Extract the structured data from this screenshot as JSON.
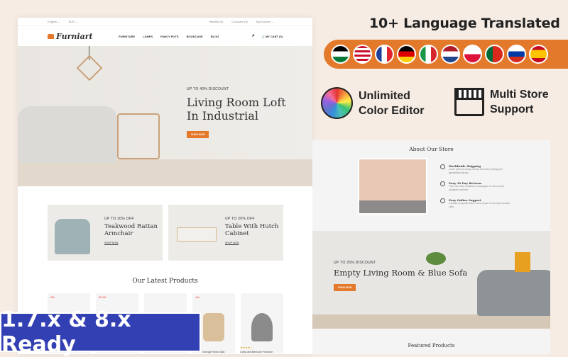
{
  "store": {
    "topbar": {
      "language": "English ⌄",
      "currency": "EUR ⌄",
      "wishlist": "Wishlist (0)",
      "compare": "Compare (0)",
      "account": "My Account ⌄"
    },
    "logo": "Furniart",
    "menu": [
      "FURNITURE",
      "LAMPS",
      "FANCY POTS",
      "BOOKCASE",
      "BLOG"
    ],
    "cart": "MY CART (0)",
    "hero": {
      "eyebrow": "UP TO 40% DISCOUNT",
      "title": "Living Room Loft In Industrial",
      "button": "SHOP NOW"
    },
    "banners": [
      {
        "eyebrow": "UP TO 30% OFF",
        "title": "Teakwood Rattan Armchair",
        "link": "SHOP NOW"
      },
      {
        "eyebrow": "UP TO 20% OFF",
        "title": "Table With Hutch Cabinet",
        "link": "SHOP NOW"
      }
    ],
    "latest_title": "Our Latest Products",
    "products": [
      {
        "badge": "-8%",
        "color": "#a94a46"
      },
      {
        "badge": "-€5.00",
        "color": "#e8a7a5"
      },
      {
        "badge": "",
        "color": "#a9c3cc"
      },
      {
        "badge": "-4%",
        "color": "#d9bf9a"
      },
      {
        "badge": "",
        "color": "#8b8b8b"
      }
    ],
    "product_names": [
      "Georgia Fabric Sofa",
      "Living and Bedroom Furniture"
    ],
    "rating": "★★★★☆"
  },
  "right": {
    "about_title": "About Our Store",
    "features": [
      {
        "title": "Worldwide Shipping",
        "text": "Lorem Ipsum is simply dummy text of the printing and typesetting industry."
      },
      {
        "title": "Easy 30 Day Returns",
        "text": "There are many variations of passages of Lorem Ipsum available some text."
      },
      {
        "title": "Easy Online Support",
        "text": "Contrary to popular belief, Lorem Ipsum is not simply random Latin."
      }
    ],
    "hero": {
      "eyebrow": "UP TO 25% DISCOUNT",
      "title": "Empty Living Room & Blue Sofa",
      "button": "SHOP NOW"
    },
    "featured_title": "Featured Products"
  },
  "promo": {
    "headline": "10+ Language Translated",
    "flags": [
      "arabic",
      "usa",
      "france",
      "germany",
      "italy",
      "netherlands",
      "poland",
      "portugal",
      "russia",
      "spain"
    ],
    "color_editor": "Unlimited Color Editor",
    "multi_store": "Multi Store Support",
    "ready": "1.7.x & 8.x Ready"
  },
  "colors": {
    "accent": "#e37a2b",
    "ready_bg": "#3340b3",
    "background": "#f6ece4"
  }
}
